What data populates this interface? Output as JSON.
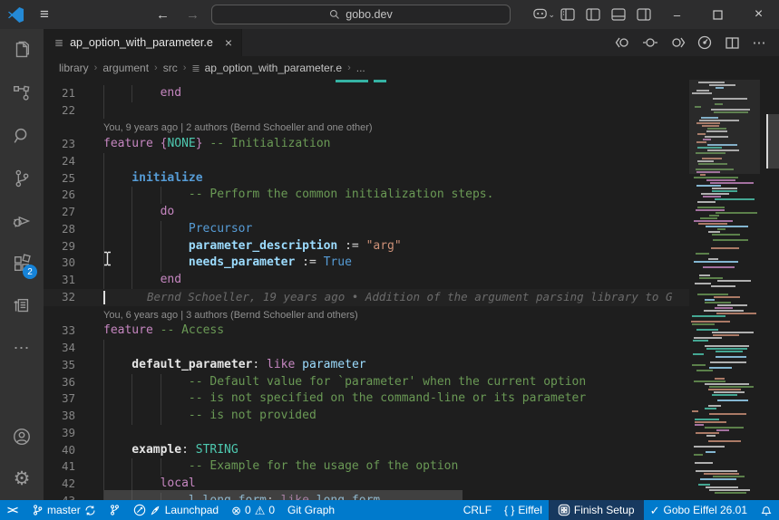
{
  "titlebar": {
    "menu_icon": "≡",
    "back_arrow": "←",
    "forward_arrow": "→",
    "search_value": "gobo.dev",
    "minimize": "–",
    "close": "×",
    "copilot_chevron": "⌄"
  },
  "activity_bar": {
    "extensions_badge": "2",
    "more_icon": "⋯",
    "settings_icon": "⚙"
  },
  "tab": {
    "file_icon": "≣",
    "title": "ap_option_with_parameter.e",
    "close": "×",
    "more_actions": "⋯"
  },
  "breadcrumbs": {
    "separator": "›",
    "items": [
      "library",
      "argument",
      "src",
      "ap_option_with_parameter.e",
      "..."
    ],
    "file_icon": "≣"
  },
  "editor": {
    "rows": [
      {
        "type": "clip"
      },
      {
        "num": "21",
        "indent": 2,
        "tokens": [
          [
            "kw",
            "end"
          ]
        ]
      },
      {
        "num": "22",
        "indent": 1,
        "tokens": []
      },
      {
        "type": "lens",
        "text": "You, 9 years ago | 2 authors (Bernd Schoeller and one other)"
      },
      {
        "num": "23",
        "indent": 0,
        "tokens": [
          [
            "kw",
            "feature"
          ],
          [
            "pln",
            " "
          ],
          [
            "kw",
            "{"
          ],
          [
            "type",
            "NONE"
          ],
          [
            "kw",
            "}"
          ],
          [
            "pln",
            " "
          ],
          [
            "cmt",
            "-- Initialization"
          ]
        ]
      },
      {
        "num": "24",
        "indent": 1,
        "tokens": []
      },
      {
        "num": "25",
        "indent": 1,
        "tokens": [
          [
            "featb",
            "initialize"
          ]
        ]
      },
      {
        "num": "26",
        "indent": 3,
        "tokens": [
          [
            "cmt",
            "-- Perform the common initialization steps."
          ]
        ]
      },
      {
        "num": "27",
        "indent": 2,
        "tokens": [
          [
            "kw",
            "do"
          ]
        ]
      },
      {
        "num": "28",
        "indent": 3,
        "tokens": [
          [
            "blue",
            "Precursor"
          ]
        ]
      },
      {
        "num": "29",
        "indent": 3,
        "tokens": [
          [
            "idb",
            "parameter_description"
          ],
          [
            "pln",
            " := "
          ],
          [
            "str",
            "\"arg\""
          ]
        ]
      },
      {
        "num": "30",
        "indent": 3,
        "tokens": [
          [
            "idb",
            "needs_parameter"
          ],
          [
            "pln",
            " := "
          ],
          [
            "blue",
            "True"
          ]
        ]
      },
      {
        "num": "31",
        "indent": 2,
        "tokens": [
          [
            "kw",
            "end"
          ]
        ]
      },
      {
        "num": "32",
        "indent": 0,
        "cursor": true,
        "tokens": [],
        "blame": "Bernd Schoeller, 19 years ago • Addition of the argument parsing library to G"
      },
      {
        "type": "lens",
        "text": "You, 6 years ago | 3 authors (Bernd Schoeller and others)"
      },
      {
        "num": "33",
        "indent": 0,
        "tokens": [
          [
            "kw",
            "feature"
          ],
          [
            "pln",
            " "
          ],
          [
            "cmt",
            "-- Access"
          ]
        ]
      },
      {
        "num": "34",
        "indent": 1,
        "tokens": []
      },
      {
        "num": "35",
        "indent": 1,
        "tokens": [
          [
            "featw",
            "default_parameter"
          ],
          [
            "pln",
            ": "
          ],
          [
            "kw",
            "like"
          ],
          [
            "pln",
            " "
          ],
          [
            "id",
            "parameter"
          ]
        ]
      },
      {
        "num": "36",
        "indent": 3,
        "tokens": [
          [
            "cmt",
            "-- Default value for `parameter' when the current option"
          ]
        ]
      },
      {
        "num": "37",
        "indent": 3,
        "tokens": [
          [
            "cmt",
            "-- is not specified on the command-line or its parameter"
          ]
        ]
      },
      {
        "num": "38",
        "indent": 3,
        "tokens": [
          [
            "cmt",
            "-- is not provided"
          ]
        ]
      },
      {
        "num": "39",
        "indent": 1,
        "tokens": []
      },
      {
        "num": "40",
        "indent": 1,
        "tokens": [
          [
            "featw",
            "example"
          ],
          [
            "pln",
            ": "
          ],
          [
            "type",
            "STRING"
          ]
        ]
      },
      {
        "num": "41",
        "indent": 3,
        "tokens": [
          [
            "cmt",
            "-- Example for the usage of the option"
          ]
        ]
      },
      {
        "num": "42",
        "indent": 2,
        "tokens": [
          [
            "kw",
            "local"
          ]
        ]
      },
      {
        "num": "43",
        "indent": 3,
        "tokens": [
          [
            "id",
            "l_long_form"
          ],
          [
            "pln",
            ": "
          ],
          [
            "kw",
            "like"
          ],
          [
            "pln",
            " "
          ],
          [
            "id",
            "long_form"
          ]
        ]
      }
    ]
  },
  "status_bar": {
    "branch": "master",
    "launchpad": "Launchpad",
    "errors": "0",
    "warnings": "0",
    "error_icon": "⊗",
    "warning_icon": "⚠",
    "git_graph": "Git Graph",
    "eol": "CRLF",
    "lang_icon": "{ }",
    "language": "Eiffel",
    "setup": "Finish Setup",
    "gobo_check": "✓",
    "gobo": "Gobo Eiffel 26.01"
  },
  "colors": {
    "status_bar": "#007acc",
    "setup_item_bg": "#17395f",
    "badge": "#1683d8",
    "keyword": "#c586c0",
    "comment": "#6a9955",
    "string": "#ce9178",
    "identifier": "#9cdcfe",
    "type": "#4ec9b0",
    "editor_bg": "#1e1e1e",
    "activity_bar_bg": "#333333",
    "title_bar_bg": "#2d2d2e"
  }
}
